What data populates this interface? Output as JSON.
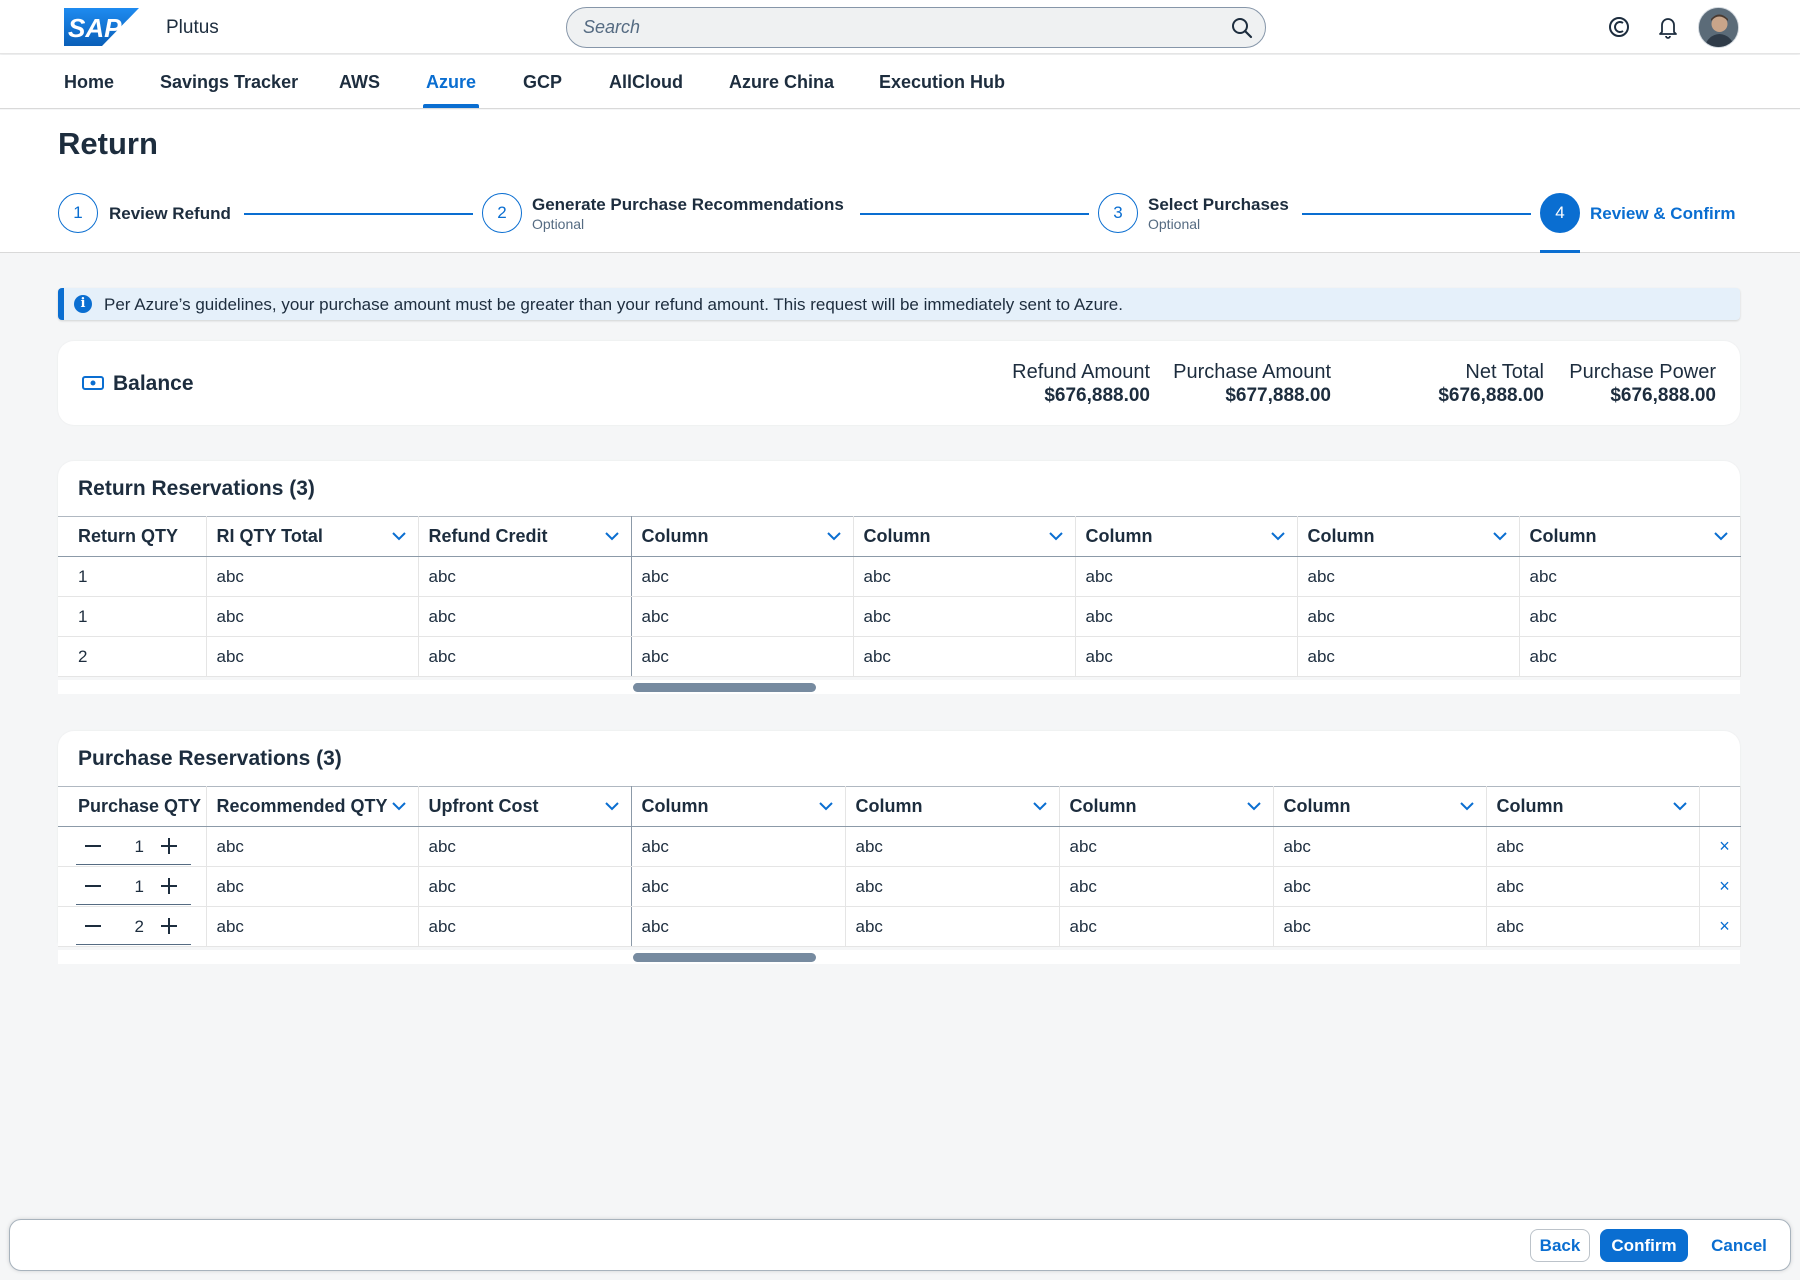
{
  "shell": {
    "logo_text": "SAP",
    "app_title": "Plutus",
    "search_placeholder": "Search",
    "icons": [
      "search-icon",
      "copilot-icon",
      "notification-bell-icon",
      "user-avatar"
    ]
  },
  "nav": {
    "items": [
      {
        "label": "Home"
      },
      {
        "label": "Savings Tracker"
      },
      {
        "label": "AWS"
      },
      {
        "label": "Azure"
      },
      {
        "label": "GCP"
      },
      {
        "label": "AllCloud"
      },
      {
        "label": "Azure China"
      },
      {
        "label": "Execution Hub"
      }
    ],
    "active": "Azure"
  },
  "page": {
    "title": "Return"
  },
  "wizard": {
    "steps": [
      {
        "number": "1",
        "label": "Review Refund",
        "sub": ""
      },
      {
        "number": "2",
        "label": "Generate Purchase Recommendations",
        "sub": "Optional"
      },
      {
        "number": "3",
        "label": "Select Purchases",
        "sub": "Optional"
      },
      {
        "number": "4",
        "label": "Review & Confirm",
        "sub": ""
      }
    ],
    "active_step": 4
  },
  "info": {
    "text": "Per Azure’s guidelines, your purchase amount must be greater than your refund amount. This request will be immediately sent to Azure."
  },
  "balance": {
    "title": "Balance",
    "metrics": [
      {
        "label": "Refund Amount",
        "value": "$676,888.00"
      },
      {
        "label": "Purchase Amount",
        "value": "$677,888.00"
      },
      {
        "label": "Net Total",
        "value": "$676,888.00"
      },
      {
        "label": "Purchase Power",
        "value": "$676,888.00"
      }
    ]
  },
  "return_table": {
    "title": "Return Reservations (3)",
    "headers": [
      "Return QTY",
      "RI QTY Total",
      "Refund Credit",
      "Column",
      "Column",
      "Column",
      "Column",
      "Column"
    ],
    "rows": [
      [
        "1",
        "abc",
        "abc",
        "abc",
        "abc",
        "abc",
        "abc",
        "abc"
      ],
      [
        "1",
        "abc",
        "abc",
        "abc",
        "abc",
        "abc",
        "abc",
        "abc"
      ],
      [
        "2",
        "abc",
        "abc",
        "abc",
        "abc",
        "abc",
        "abc",
        "abc"
      ]
    ]
  },
  "purchase_table": {
    "title": "Purchase Reservations (3)",
    "headers": [
      "Purchase QTY",
      "Recommended QTY",
      "Upfront Cost",
      "Column",
      "Column",
      "Column",
      "Column",
      "Column"
    ],
    "rows": [
      {
        "qty": "1",
        "cells": [
          "abc",
          "abc",
          "abc",
          "abc",
          "abc",
          "abc",
          "abc"
        ],
        "remove": "×"
      },
      {
        "qty": "1",
        "cells": [
          "abc",
          "abc",
          "abc",
          "abc",
          "abc",
          "abc",
          "abc"
        ],
        "remove": "×"
      },
      {
        "qty": "2",
        "cells": [
          "abc",
          "abc",
          "abc",
          "abc",
          "abc",
          "abc",
          "abc"
        ],
        "remove": "×"
      }
    ]
  },
  "footer": {
    "back_label": "Back",
    "confirm_label": "Confirm",
    "cancel_label": "Cancel"
  },
  "colors": {
    "accent": "#0a6ed1",
    "text": "#1d2d3e",
    "background": "#f5f6f7",
    "info_background": "#e5f0fa"
  }
}
